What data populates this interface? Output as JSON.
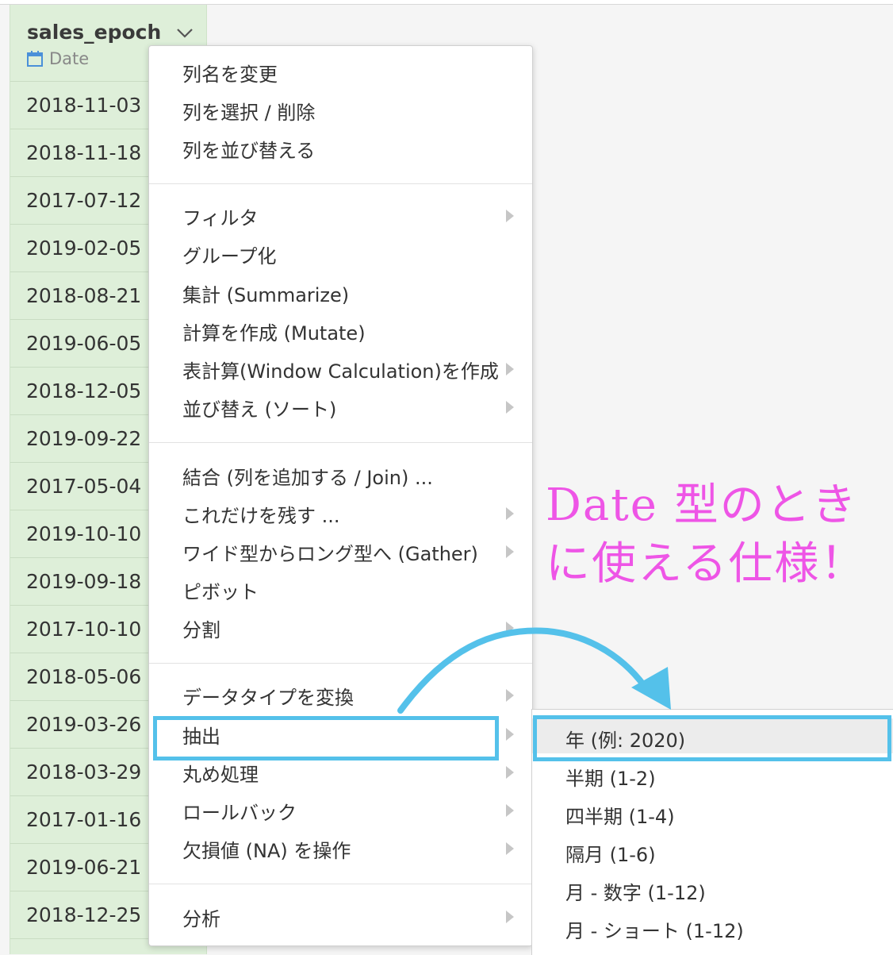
{
  "column": {
    "name": "sales_epoch",
    "type_label": "Date",
    "rows": [
      "2018-11-03",
      "2018-11-18",
      "2017-07-12",
      "2019-02-05",
      "2018-08-21",
      "2019-06-05",
      "2018-12-05",
      "2019-09-22",
      "2017-05-04",
      "2019-10-10",
      "2019-09-18",
      "2017-10-10",
      "2018-05-06",
      "2019-03-26",
      "2018-03-29",
      "2017-01-16",
      "2019-06-21",
      "2018-12-25"
    ]
  },
  "main_menu": {
    "items": [
      {
        "label": "列名を変更",
        "submenu": false
      },
      {
        "label": "列を選択 / 削除",
        "submenu": false
      },
      {
        "label": "列を並び替える",
        "submenu": false
      },
      {
        "label": "フィルタ",
        "submenu": true
      },
      {
        "label": "グループ化",
        "submenu": false
      },
      {
        "label": "集計 (Summarize)",
        "submenu": false
      },
      {
        "label": "計算を作成 (Mutate)",
        "submenu": false
      },
      {
        "label": "表計算(Window Calculation)を作成",
        "submenu": true
      },
      {
        "label": "並び替え (ソート)",
        "submenu": true
      },
      {
        "label": "結合 (列を追加する / Join) ...",
        "submenu": false
      },
      {
        "label": "これだけを残す ...",
        "submenu": true
      },
      {
        "label": "ワイド型からロング型へ (Gather)",
        "submenu": true
      },
      {
        "label": "ピボット",
        "submenu": false
      },
      {
        "label": "分割",
        "submenu": true
      },
      {
        "label": "データタイプを変換",
        "submenu": true
      },
      {
        "label": "抽出",
        "submenu": true
      },
      {
        "label": "丸め処理",
        "submenu": true
      },
      {
        "label": "ロールバック",
        "submenu": true
      },
      {
        "label": "欠損値 (NA) を操作",
        "submenu": true
      },
      {
        "label": "分析",
        "submenu": true
      }
    ]
  },
  "sub_menu": {
    "items": [
      {
        "label": "年 (例: 2020)"
      },
      {
        "label": "半期 (1-2)"
      },
      {
        "label": "四半期 (1-4)"
      },
      {
        "label": "隔月 (1-6)"
      },
      {
        "label": "月 - 数字 (1-12)"
      },
      {
        "label": "月 - ショート (1-12)"
      }
    ]
  },
  "annotation": {
    "line1": "Date 型のとき",
    "line2": "に使える仕様！"
  },
  "colors": {
    "column_bg": "#deefd9",
    "highlight": "#54c1ea",
    "annotation": "#ee55e6",
    "calendar_icon": "#4a90d9"
  }
}
